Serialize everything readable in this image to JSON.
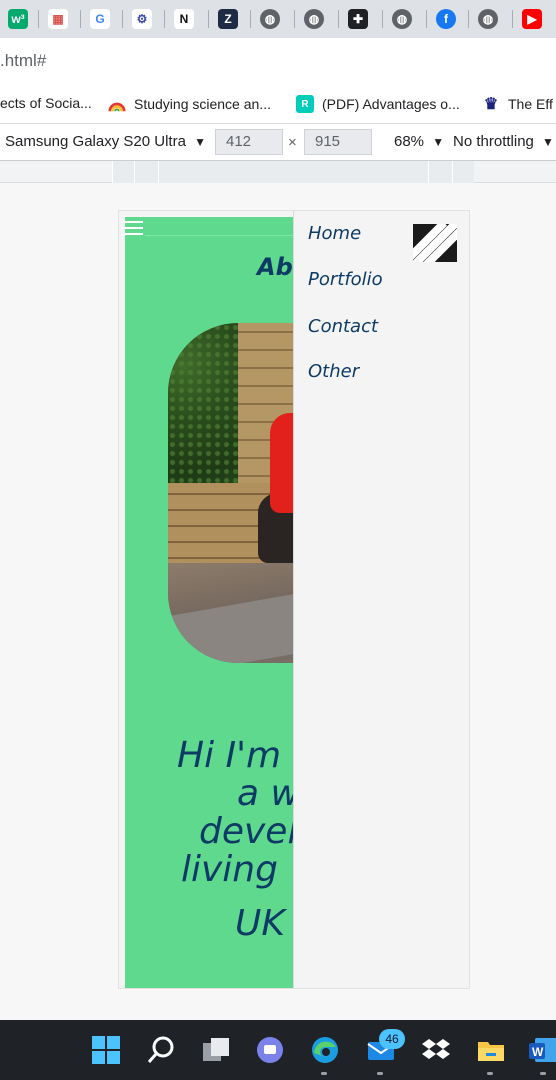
{
  "browser": {
    "tabs": [
      {
        "icon": "w3schools-icon",
        "glyph": "w³",
        "color": "#04aa6d",
        "fg": "#ffffff"
      },
      {
        "icon": "colorful-grid-icon",
        "glyph": "▦",
        "color": "#ffffff",
        "fg": "#d9534f"
      },
      {
        "icon": "google-icon",
        "glyph": "G",
        "color": "#ffffff",
        "fg": "#4285f4"
      },
      {
        "icon": "gear-seal-icon",
        "glyph": "⚙",
        "color": "#ffffff",
        "fg": "#3949ab"
      },
      {
        "icon": "uon-logo-icon",
        "glyph": "N",
        "color": "#ffffff",
        "fg": "#111111"
      },
      {
        "icon": "z-logo-icon",
        "glyph": "Z",
        "color": "#1f2a44",
        "fg": "#ffffff"
      },
      {
        "icon": "globe-icon",
        "glyph": "◍",
        "color": "#5f6368",
        "fg": "#ffffff"
      },
      {
        "icon": "globe-icon",
        "glyph": "◍",
        "color": "#5f6368",
        "fg": "#ffffff"
      },
      {
        "icon": "handshake-icon",
        "glyph": "✚",
        "color": "#202124",
        "fg": "#ffffff"
      },
      {
        "icon": "globe-icon",
        "glyph": "◍",
        "color": "#5f6368",
        "fg": "#ffffff"
      },
      {
        "icon": "facebook-icon",
        "glyph": "f",
        "color": "#1877f2",
        "fg": "#ffffff"
      },
      {
        "icon": "globe-icon",
        "glyph": "◍",
        "color": "#5f6368",
        "fg": "#ffffff"
      },
      {
        "icon": "youtube-icon",
        "glyph": "▶",
        "color": "#ff0000",
        "fg": "#ffffff"
      }
    ],
    "url": ".html#",
    "bookmarks": [
      {
        "label": "ects of Socia...",
        "icon": ""
      },
      {
        "label": "Studying science an...",
        "icon": "rainbow-arc-icon",
        "color": "#f4a300"
      },
      {
        "label": "(PDF) Advantages o...",
        "icon": "researchgate-icon",
        "glyph": "R",
        "color": "#00ccbb"
      },
      {
        "label": "The Eff",
        "icon": "crest-icon",
        "glyph": "♛",
        "color": "#1a237e"
      }
    ]
  },
  "devtools": {
    "device": "Samsung Galaxy S20 Ultra",
    "width": "412",
    "times": "×",
    "height": "915",
    "zoom": "68%",
    "throttling": "No throttling"
  },
  "site": {
    "heading": "Abo",
    "hero_lines": [
      "Hi I'm",
      "a w",
      "devel",
      "living",
      "UK"
    ],
    "nav": [
      "Home",
      "Portfolio",
      "Contact",
      "Other"
    ]
  },
  "taskbar": {
    "mail_badge": "46"
  },
  "colors": {
    "page_green": "#5fd98e",
    "text_navy": "#0d3b66"
  }
}
